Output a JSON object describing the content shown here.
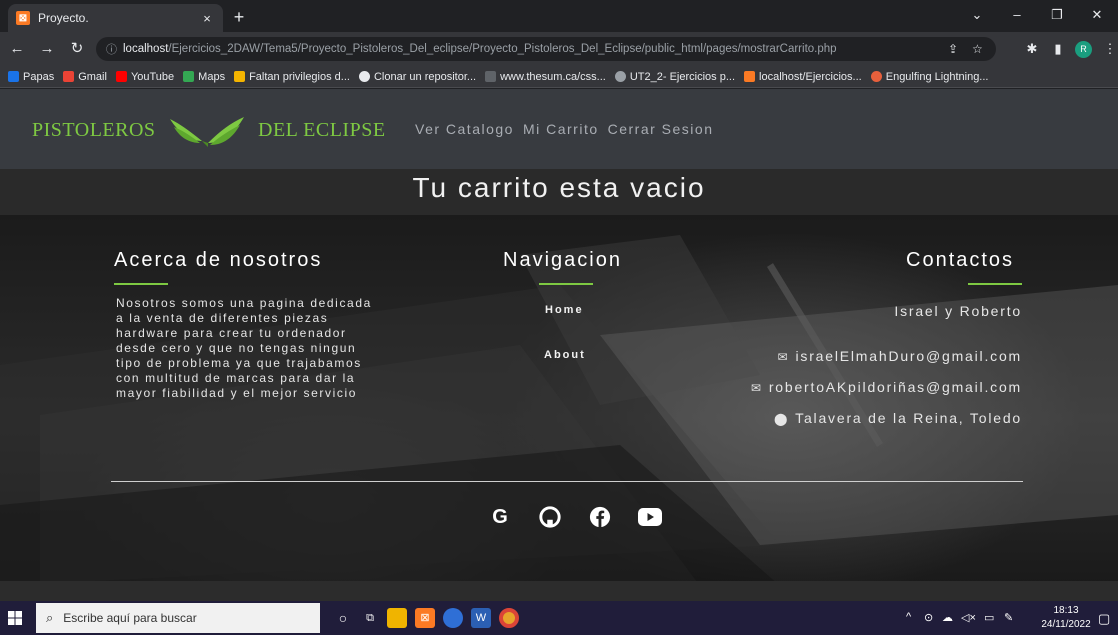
{
  "browser": {
    "tab_title": "Proyecto.",
    "tab_close": "×",
    "new_tab": "+",
    "url_host": "localhost",
    "url_path": "/Ejercicios_2DAW/Tema5/Proyecto_Pistoleros_Del_eclipse/Proyecto_Pistoleros_Del_Eclipse/public_html/pages/mostrarCarrito.php",
    "profile_initial": "R",
    "bookmarks": [
      {
        "label": "Papas",
        "color": "#1a73e8"
      },
      {
        "label": "Gmail",
        "color": "#ea4335"
      },
      {
        "label": "YouTube",
        "color": "#ff0000"
      },
      {
        "label": "Maps",
        "color": "#34a853"
      },
      {
        "label": "Faltan privilegios d...",
        "color": "#f4b400"
      },
      {
        "label": "Clonar un repositor...",
        "color": "#e8eaed"
      },
      {
        "label": "www.thesum.ca/css...",
        "color": "#5f6368"
      },
      {
        "label": "UT2_2- Ejercicios p...",
        "color": "#9aa0a6"
      },
      {
        "label": "localhost/Ejercicios...",
        "color": "#fb7a24"
      },
      {
        "label": "Engulfing Lightning...",
        "color": "#e8603c"
      }
    ]
  },
  "site": {
    "brand_left": "PISTOLEROS",
    "brand_right": "DEL ECLIPSE",
    "nav": [
      "Ver Catalogo",
      "Mi Carrito",
      "Cerrar Sesion"
    ],
    "empty_message": "Tu carrito esta vacio",
    "accent_color": "#7ec942"
  },
  "footer": {
    "about_title": "Acerca de nosotros",
    "about_lines": [
      "Nosotros somos una pagina dedicada",
      "a la venta de diferentes piezas",
      "hardware para crear tu ordenador",
      "desde cero y que no tengas ningun",
      "tipo de problema ya que trajabamos",
      "con multitud de marcas para dar la",
      "mayor fiabilidad y el mejor servicio"
    ],
    "nav_title": "Navigacion",
    "nav_links": [
      "Home",
      "About"
    ],
    "contact_title": "Contactos",
    "contact_names": "Israel y Roberto",
    "email_1": "israelElmahDuro@gmail.com",
    "email_2": "robertoAKpildoriñas@gmail.com",
    "location": "Talavera de la Reina, Toledo",
    "socials": [
      "google-icon",
      "github-icon",
      "facebook-icon",
      "youtube-icon"
    ]
  },
  "taskbar": {
    "search_placeholder": "Escribe aquí para buscar",
    "time": "18:13",
    "date": "24/11/2022"
  }
}
